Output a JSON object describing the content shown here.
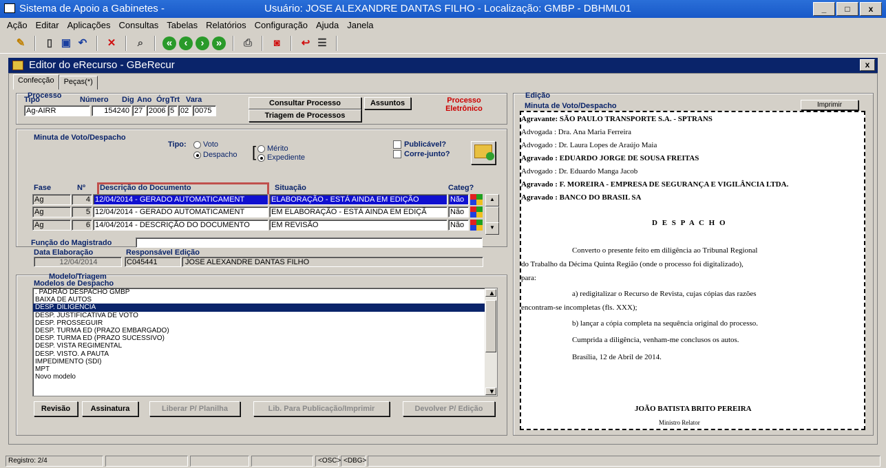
{
  "window": {
    "title": "Sistema de Apoio a Gabinetes -",
    "user_info": "Usuário: JOSE ALEXANDRE DANTAS FILHO - Localização: GMBP - DBHML01",
    "min": "_",
    "max": "□",
    "close": "x"
  },
  "menu": [
    "Ação",
    "Editar",
    "Aplicações",
    "Consultas",
    "Tabelas",
    "Relatórios",
    "Configuração",
    "Ajuda",
    "Janela"
  ],
  "editor": {
    "title": "Editor do eRecurso - GBeRecur",
    "close": "x",
    "tabs": [
      "Confecção",
      "Peças(*)"
    ]
  },
  "processo": {
    "legend": "Processo",
    "labels": {
      "tipo": "Tipo",
      "numero": "Número",
      "dig": "Dig",
      "ano": "Ano",
      "org": "Órg",
      "trt": "Trt",
      "vara": "Vara"
    },
    "tipo": "Ag-AIRR",
    "numero": "154240",
    "dig": "27",
    "ano": "2006",
    "org": "5",
    "trt": "02",
    "vara": "0075",
    "consultar": "Consultar Processo",
    "assuntos": "Assuntos",
    "triagem": "Triagem de Processos",
    "eletronico": "Processo Eletrônico"
  },
  "minuta": {
    "legend": "Minuta de Voto/Despacho",
    "tipo_label": "Tipo:",
    "voto": "Voto",
    "despacho": "Despacho",
    "merito": "Mérito",
    "expediente": "Expediente",
    "publicavel": "Publicável?",
    "corre_junto": "Corre-junto?",
    "headers": {
      "fase": "Fase",
      "n": "Nº",
      "descricao": "Descrição do Documento",
      "situacao": "Situação",
      "categ": "Categ?"
    },
    "rows": [
      {
        "fase": "Ag",
        "n": "4",
        "descricao": "12/04/2014 - GERADO AUTOMATICAMENT",
        "situacao": "ELABORAÇÃO - ESTÁ AINDA EM EDIÇÃO",
        "categ": "Não"
      },
      {
        "fase": "Ag",
        "n": "5",
        "descricao": "12/04/2014 - GERADO AUTOMATICAMENT",
        "situacao": "EM ELABORAÇÃO - ESTÁ AINDA EM EDIÇÃ",
        "categ": "Não"
      },
      {
        "fase": "Ag",
        "n": "6",
        "descricao": "14/04/2014 - DESCRIÇÃO DO DOCUMENTO",
        "situacao": "EM REVISÃO",
        "categ": "Não"
      }
    ],
    "funcao_label": "Função do Magistrado",
    "data_label": "Data Elaboração",
    "resp_label": "Responsável Edição",
    "data": "12/04/2014",
    "resp_code": "C045441",
    "resp_name": "JOSE ALEXANDRE DANTAS FILHO"
  },
  "modelo": {
    "legend": "Modelo/Triagem",
    "sub": "Modelos de Despacho",
    "items": [
      ". PADRÃO DESPACHO GMBP",
      "BAIXA DE AUTOS",
      "DESP. DILIGÊNCIA",
      "DESP. JUSTIFICATIVA DE VOTO",
      "DESP. PROSSEGUIR",
      "DESP. TURMA ED (PRAZO EMBARGADO)",
      "DESP. TURMA ED (PRAZO SUCESSIVO)",
      "DESP. VISTA REGIMENTAL",
      "DESP. VISTO. A PAUTA",
      "IMPEDIMENTO (SDI)",
      "MPT",
      "Novo modelo"
    ],
    "selected": 2
  },
  "buttons": {
    "revisao": "Revisão",
    "assinatura": "Assinatura",
    "liberar": "Liberar P/ Planilha",
    "lib_pub": "Lib. Para Publicação/Imprimir",
    "devolver": "Devolver P/ Edição"
  },
  "edicao": {
    "legend": "Edição",
    "title": "Minuta de Voto/Despacho",
    "imprimir": "Imprimir",
    "lines": [
      "Agravante: SÃO PAULO TRANSPORTE S.A. - SPTRANS",
      "Advogada : Dra. Ana Maria Ferreira",
      "Advogado : Dr. Laura Lopes de Araújo Maia",
      "Agravado : EDUARDO JORGE DE SOUSA FREITAS",
      "Advogado : Dr. Eduardo Manga Jacob",
      "Agravado : F. MOREIRA - EMPRESA DE SEGURANÇA E VIGILÂNCIA LTDA.",
      "Agravado : BANCO DO BRASIL SA"
    ],
    "heading": "D E S P A C H O",
    "p1a": "Converto o presente feito em diligência ao Tribunal Regional",
    "p1b": "do Trabalho da Décima Quinta Região (onde o processo foi digitalizado),",
    "p1c": "para:",
    "a1": "a) redigitalizar o Recurso de Revista, cujas cópias das razões",
    "a2": "encontram-se incompletas (fls. XXX);",
    "b1": "b) lançar a cópia completa na sequência original do processo.",
    "c1": "Cumprida a diligência, venham-me conclusos os autos.",
    "date": "Brasília, 12 de Abril de 2014.",
    "sign": "JOÃO BATISTA BRITO PEREIRA",
    "role": "Ministro Relator"
  },
  "status": {
    "registro": "Registro: 2/4",
    "osc": "<OSC>",
    "dbg": "<DBG>"
  },
  "colors": {
    "title_bar": "#1858c8",
    "child_title": "#0a246a",
    "highlight_box": "#c0504d",
    "red_text": "#cc0000"
  }
}
